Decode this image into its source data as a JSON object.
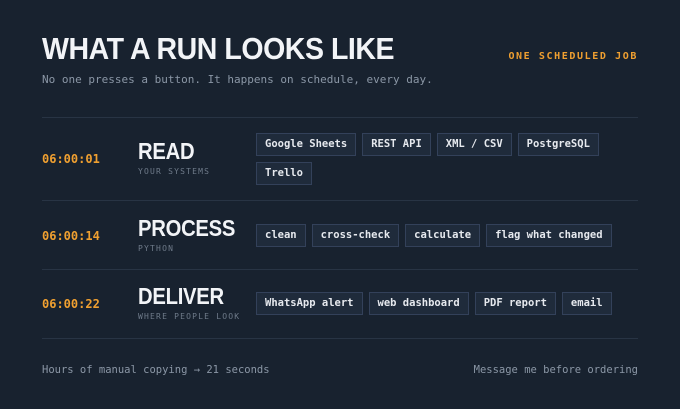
{
  "header": {
    "title": "WHAT A RUN LOOKS LIKE",
    "badge": "ONE SCHEDULED JOB",
    "subtitle": "No one presses a button. It happens on schedule, every day."
  },
  "rows": [
    {
      "time": "06:00:01",
      "name": "READ",
      "sub": "YOUR SYSTEMS",
      "tags": [
        "Google Sheets",
        "REST API",
        "XML / CSV",
        "PostgreSQL",
        "Trello"
      ]
    },
    {
      "time": "06:00:14",
      "name": "PROCESS",
      "sub": "PYTHON",
      "tags": [
        "clean",
        "cross-check",
        "calculate",
        "flag what changed"
      ]
    },
    {
      "time": "06:00:22",
      "name": "DELIVER",
      "sub": "WHERE PEOPLE LOOK",
      "tags": [
        "WhatsApp alert",
        "web dashboard",
        "PDF report",
        "email"
      ]
    }
  ],
  "footer": {
    "left": "Hours of manual copying → 21 seconds",
    "right": "Message me before ordering"
  }
}
